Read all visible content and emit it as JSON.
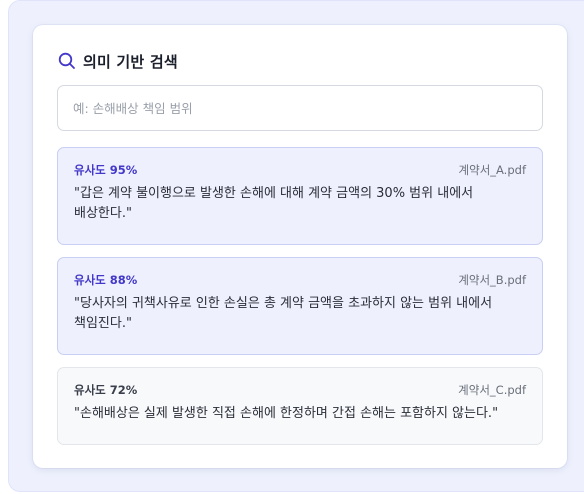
{
  "panel": {
    "title": "의미 기반 검색",
    "search_icon": "search-icon",
    "accent_color": "#4338ca"
  },
  "search": {
    "placeholder": "예: 손해배상 책임 범위",
    "value": ""
  },
  "results": [
    {
      "similarity": "유사도 95%",
      "file": "계약서_A.pdf",
      "snippet": "\"갑은 계약 불이행으로 발생한 손해에 대해 계약 금액의 30% 범위 내에서 배상한다.\""
    },
    {
      "similarity": "유사도 88%",
      "file": "계약서_B.pdf",
      "snippet": "\"당사자의 귀책사유로 인한 손실은 총 계약 금액을 초과하지 않는 범위 내에서 책임진다.\""
    },
    {
      "similarity": "유사도 72%",
      "file": "계약서_C.pdf",
      "snippet": "\"손해배상은 실제 발생한 직접 손해에 한정하며 간접 손해는 포함하지 않는다.\""
    }
  ]
}
